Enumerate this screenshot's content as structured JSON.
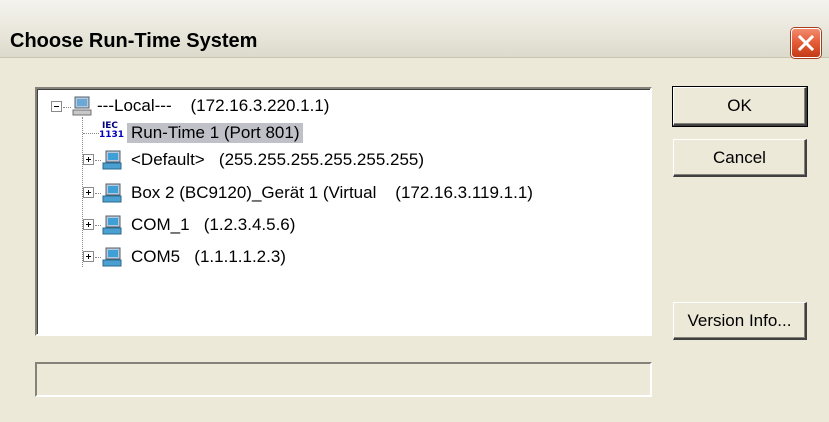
{
  "window": {
    "title": "Choose Run-Time System",
    "close_icon": "close-icon"
  },
  "tree": {
    "root": {
      "name": "---Local---",
      "address": "(172.16.3.220.1.1)",
      "icon": "computer-icon"
    },
    "runtime": {
      "icon_label_top": "IEC",
      "icon_label_bottom": "1131",
      "name": "Run-Time 1 (Port 801)",
      "icon": "iec-runtime-icon"
    },
    "nodes": [
      {
        "name": "<Default>",
        "address": "(255.255.255.255.255.255)",
        "icon": "network-computer-icon"
      },
      {
        "name": "Box 2 (BC9120)_Gerät 1 (Virtual",
        "address": "(172.16.3.119.1.1)",
        "icon": "network-computer-icon"
      },
      {
        "name": "COM_1",
        "address": "(1.2.3.4.5.6)",
        "icon": "network-computer-icon"
      },
      {
        "name": "COM5",
        "address": "(1.1.1.1.2.3)",
        "icon": "network-computer-icon"
      }
    ]
  },
  "buttons": {
    "ok": "OK",
    "cancel": "Cancel",
    "version_info": "Version Info..."
  },
  "status": {
    "text": ""
  },
  "colors": {
    "background": "#ece9d8",
    "selection": "#c0c0c8",
    "close": "#e35a36"
  }
}
